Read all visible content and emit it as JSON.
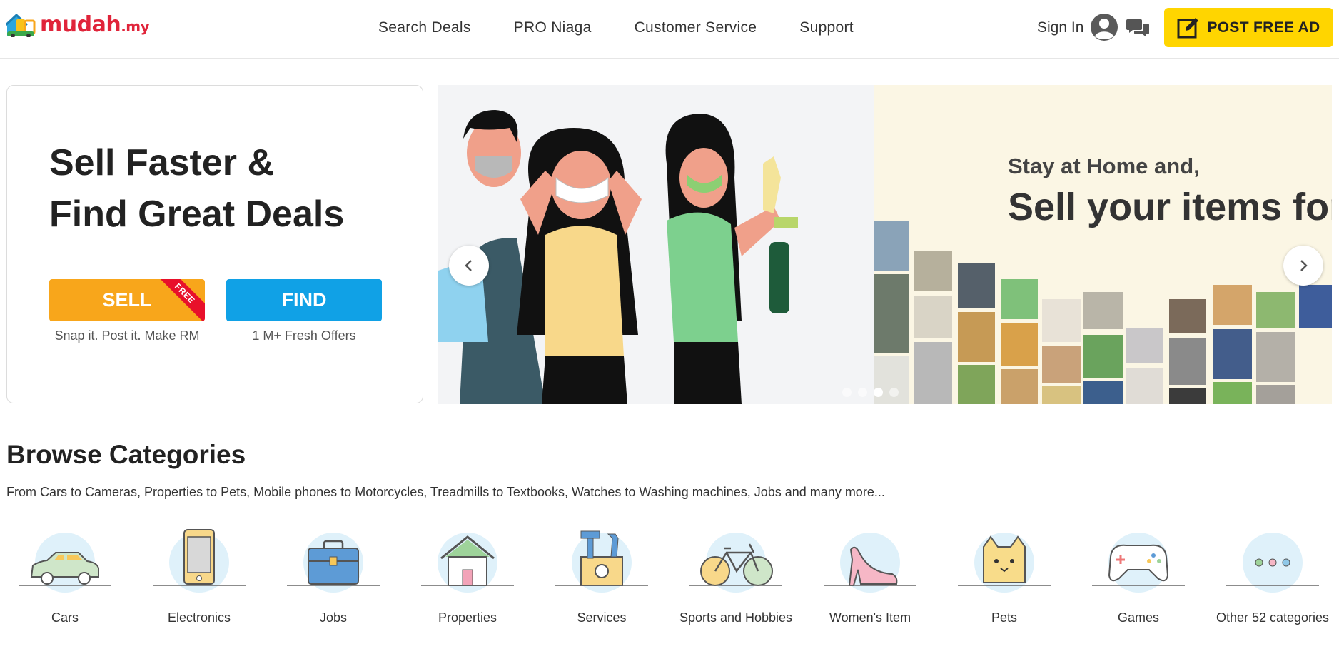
{
  "header": {
    "logo_main": "mudah",
    "logo_suffix": ".my",
    "nav": [
      "Search Deals",
      "PRO Niaga",
      "Customer Service",
      "Support"
    ],
    "sign_in": "Sign In",
    "post_ad": "POST FREE AD",
    "icons": {
      "profile": "user-avatar-icon",
      "chat": "chat-bubbles-icon",
      "post": "edit-square-icon"
    }
  },
  "hero": {
    "title_line1": "Sell Faster &",
    "title_line2": "Find Great Deals",
    "sell_label": "SELL",
    "free_badge": "FREE",
    "sell_sub": "Snap it. Post it. Make RM",
    "find_label": "FIND",
    "find_sub": "1 M+ Fresh Offers"
  },
  "carousel": {
    "slide_heading_small": "Stay at Home and,",
    "slide_heading_large": "Sell your items for",
    "dots": 4,
    "active_dot": 2
  },
  "browse": {
    "title": "Browse Categories",
    "subtitle": "From Cars to Cameras, Properties to Pets, Mobile phones to Motorcycles, Treadmills to Textbooks, Watches to Washing machines, Jobs and many more...",
    "categories": [
      {
        "label": "Cars",
        "icon": "car-icon"
      },
      {
        "label": "Electronics",
        "icon": "smartphone-icon"
      },
      {
        "label": "Jobs",
        "icon": "briefcase-icon"
      },
      {
        "label": "Properties",
        "icon": "house-icon"
      },
      {
        "label": "Services",
        "icon": "toolbox-icon"
      },
      {
        "label": "Sports and Hobbies",
        "icon": "bicycle-icon"
      },
      {
        "label": "Women's Item",
        "icon": "high-heel-icon"
      },
      {
        "label": "Pets",
        "icon": "cat-icon"
      },
      {
        "label": "Games",
        "icon": "gamepad-icon"
      },
      {
        "label": "Other 52 categories",
        "icon": "more-dots-icon"
      }
    ]
  },
  "colors": {
    "brand_red": "#e0243a",
    "post_yellow": "#ffd500",
    "sell_orange": "#f8a61b",
    "find_blue": "#10a1e6",
    "ribbon_red": "#e8102a"
  }
}
